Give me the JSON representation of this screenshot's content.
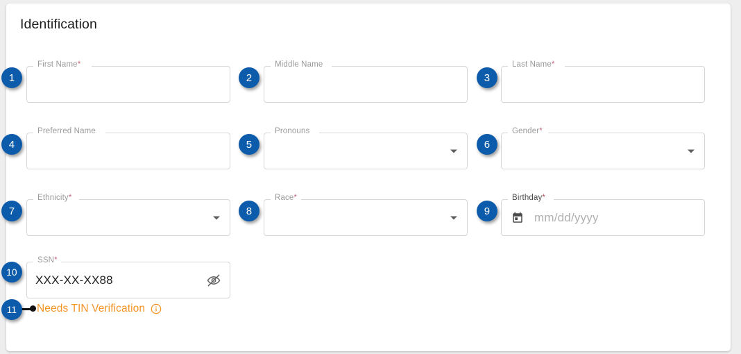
{
  "page": {
    "title": "Identification",
    "background_color": "#eeeeee",
    "card_color": "#ffffff"
  },
  "colors": {
    "badge_blue": "#0d5cab",
    "warning_orange": "#f59426",
    "field_border": "#d6d6d6",
    "label_gray": "#9a9a9a",
    "required_asterisk": "#c06b7e"
  },
  "fields": [
    {
      "id": "first-name",
      "badge": "1",
      "label": "First Name",
      "required": true,
      "required_marker": "*",
      "type": "text",
      "value": "",
      "placeholder": ""
    },
    {
      "id": "middle-name",
      "badge": "2",
      "label": "Middle Name",
      "required": false,
      "required_marker": "",
      "type": "text",
      "value": "",
      "placeholder": ""
    },
    {
      "id": "last-name",
      "badge": "3",
      "label": "Last Name",
      "required": true,
      "required_marker": "*",
      "type": "text",
      "value": "",
      "placeholder": ""
    },
    {
      "id": "preferred-name",
      "badge": "4",
      "label": "Preferred Name",
      "required": false,
      "required_marker": "",
      "type": "text",
      "value": "",
      "placeholder": ""
    },
    {
      "id": "pronouns",
      "badge": "5",
      "label": "Pronouns",
      "required": false,
      "required_marker": "",
      "type": "select",
      "value": "",
      "placeholder": ""
    },
    {
      "id": "gender",
      "badge": "6",
      "label": "Gender",
      "required": true,
      "required_marker": "*",
      "type": "select",
      "value": "",
      "placeholder": ""
    },
    {
      "id": "ethnicity",
      "badge": "7",
      "label": "Ethnicity",
      "required": true,
      "required_marker": "*",
      "type": "select",
      "value": "",
      "placeholder": ""
    },
    {
      "id": "race",
      "badge": "8",
      "label": "Race",
      "required": true,
      "required_marker": "*",
      "type": "select",
      "value": "",
      "placeholder": ""
    },
    {
      "id": "birthday",
      "badge": "9",
      "label": "Birthday",
      "required": true,
      "required_marker": "*",
      "type": "date",
      "value": "",
      "placeholder": "mm/dd/yyyy",
      "icon": "calendar-icon"
    },
    {
      "id": "ssn",
      "badge": "10",
      "label": "SSN",
      "required": true,
      "required_marker": "*",
      "type": "masked-text",
      "value": "XXX-XX-XX88",
      "placeholder": "",
      "icon": "eye-off-icon"
    }
  ],
  "tin_note": {
    "badge": "11",
    "text": "Needs TIN Verification",
    "icon": "info-icon",
    "color": "#f59426"
  }
}
